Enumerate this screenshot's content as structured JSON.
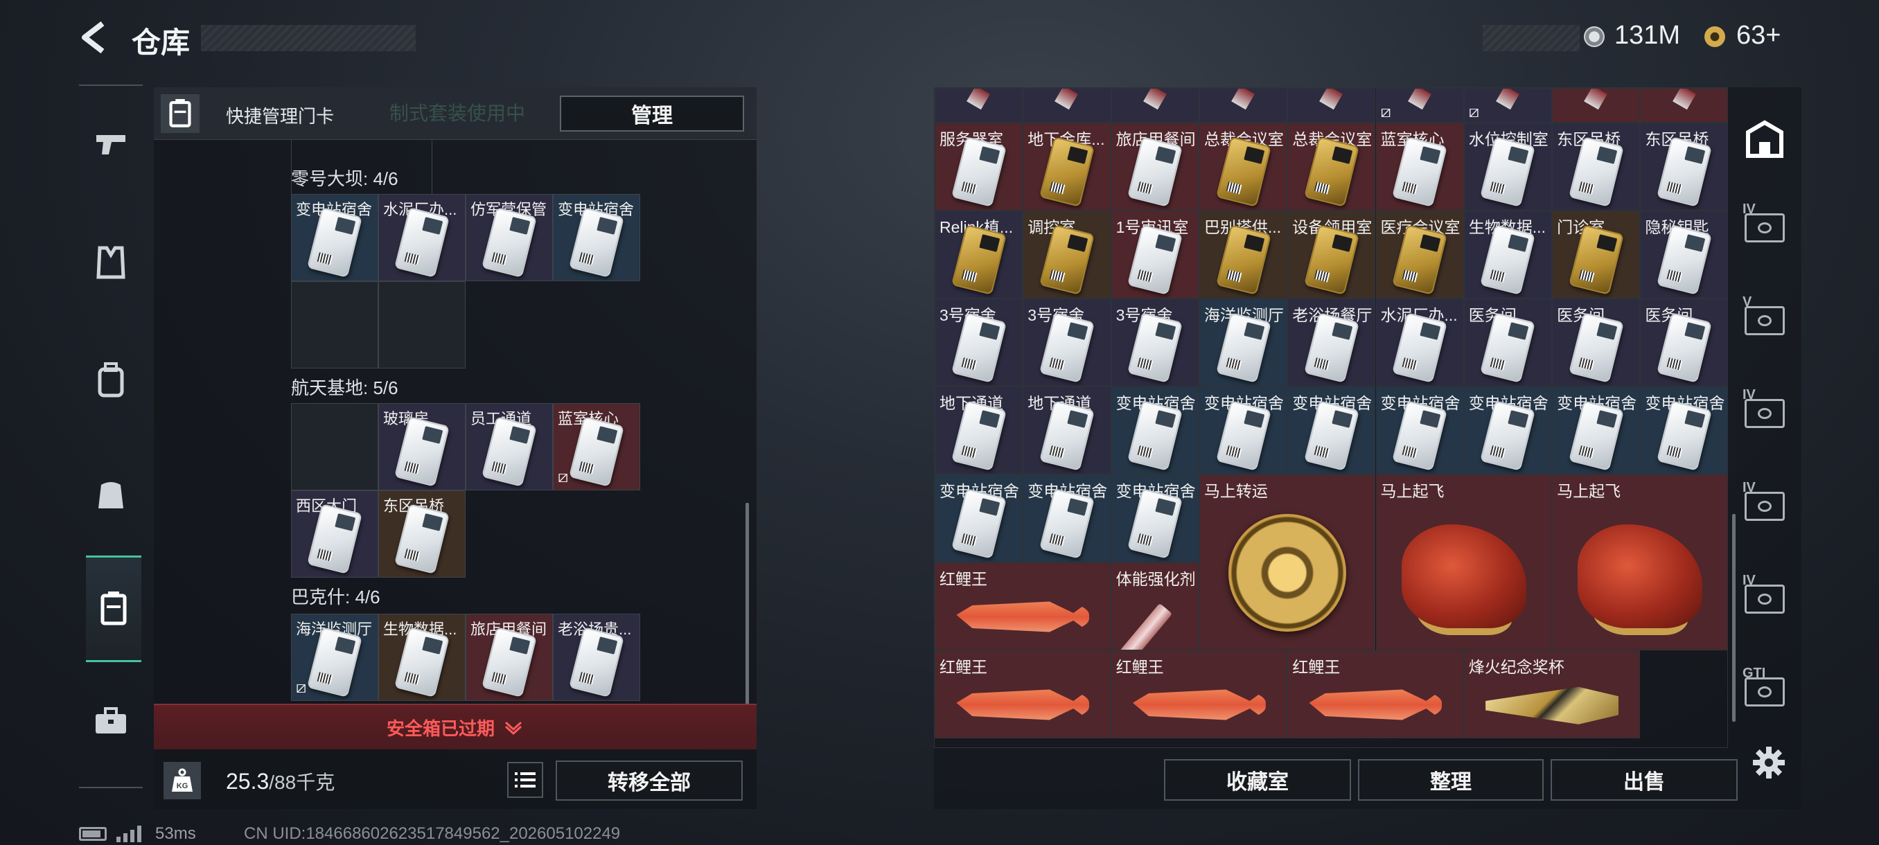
{
  "header": {
    "back_icon": "back-arrow-icon",
    "title": "仓库",
    "currency1_icon": "coin-icon",
    "currency1": "131M",
    "currency2_icon": "gold-coin-icon",
    "currency2": "63+"
  },
  "left_nav": {
    "items": [
      {
        "icon": "pistol-icon"
      },
      {
        "icon": "armor-vest-icon"
      },
      {
        "icon": "backpack-icon"
      },
      {
        "icon": "chest-rig-icon"
      },
      {
        "icon": "keycard-holder-icon",
        "active": true
      },
      {
        "icon": "toolbox-icon"
      }
    ]
  },
  "keycard_panel": {
    "icon": "keycard-holder-icon",
    "quick_manage_label": "快捷管理门卡",
    "faded_notice": "制式套装使用中",
    "manage_button": "管理",
    "sections": [
      {
        "title": "零号大坝: 4/6",
        "cells": [
          "变电站宿舍",
          "水泥厂办...",
          "仿军营保管",
          "变电站宿舍",
          "",
          ""
        ]
      },
      {
        "title": "航天基地: 5/6",
        "cells": [
          "",
          "玻璃房",
          "员工通道",
          "蓝室核心",
          "西区大门",
          "东区吊桥"
        ]
      },
      {
        "title": "巴克什: 4/6",
        "cells": [
          "海洋监测厅",
          "生物数据...",
          "旅店用餐间",
          "老浴场贵..."
        ]
      }
    ],
    "safe_box_expired": "安全箱已过期",
    "weight_icon": "kg-weight-icon",
    "weight_value": "25.3",
    "weight_max": "/88千克",
    "list_icon": "list-icon",
    "transfer_all_button": "转移全部"
  },
  "storage": {
    "rows": [
      [
        "服务器室",
        "地下金库...",
        "旅店用餐间",
        "总裁会议室",
        "总裁会议室",
        "蓝室核心",
        "水位控制室",
        "东区吊桥",
        "东区吊桥"
      ],
      [
        "Relink植...",
        "调控室",
        "1号审讯室",
        "巴别塔供...",
        "设备领用室",
        "医疗会议室",
        "生物数据...",
        "门诊室",
        "隐秘钥匙"
      ],
      [
        "3号宿舍",
        "3号宿舍",
        "3号宿舍",
        "海洋监测厅",
        "老浴场餐厅",
        "水泥厂办...",
        "医务间",
        "医务间",
        "医务间"
      ],
      [
        "地下通道",
        "地下通道",
        "变电站宿舍",
        "变电站宿舍",
        "变电站宿舍",
        "变电站宿舍",
        "变电站宿舍",
        "变电站宿舍",
        "变电站宿舍"
      ],
      [
        "变电站宿舍",
        "变电站宿舍",
        "变电站宿舍"
      ]
    ],
    "big_items": [
      {
        "label": "马上转运",
        "icon": "golden-horse-wheel-icon"
      },
      {
        "label": "马上起飞",
        "icon": "red-horse-statue-icon"
      },
      {
        "label": "马上起飞",
        "icon": "red-horse-statue-icon"
      },
      {
        "label": "红鲤王",
        "icon": "red-carp-fish-icon"
      },
      {
        "label": "体能强化剂",
        "icon": "syringe-icon"
      },
      {
        "label": "红鲤王",
        "icon": "red-carp-fish-icon"
      },
      {
        "label": "红鲤王",
        "icon": "red-carp-fish-icon"
      },
      {
        "label": "红鲤王",
        "icon": "red-carp-fish-icon"
      },
      {
        "label": "烽火纪念奖杯",
        "icon": "trophy-icon"
      }
    ],
    "buttons": {
      "collection": "收藏室",
      "sort": "整理",
      "sell": "出售"
    }
  },
  "right_tabs": [
    {
      "icon": "safe-box-icon"
    },
    {
      "icon": "storage-case-icon",
      "label": "IV"
    },
    {
      "icon": "storage-case-icon",
      "label": "V"
    },
    {
      "icon": "storage-case-icon",
      "label": "IV"
    },
    {
      "icon": "storage-case-icon",
      "label": "IV"
    },
    {
      "icon": "storage-case-icon",
      "label": "IV"
    },
    {
      "icon": "gti-case-icon",
      "label": "GTI"
    }
  ],
  "settings_icon": "gear-icon",
  "status_bar": {
    "battery_icon": "battery-icon",
    "signal_icon": "signal-bars-icon",
    "ping": "53ms",
    "uid": "CN UID:1846686026235178495​62_202605102249"
  }
}
